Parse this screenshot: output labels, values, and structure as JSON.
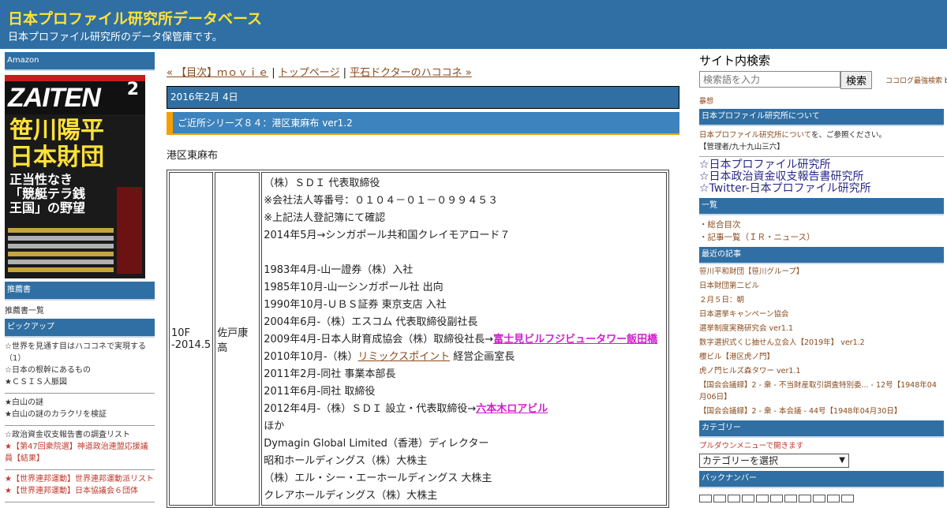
{
  "header": {
    "title": "日本プロファイル研究所データベース",
    "subtitle": "日本プロファイル研究所のデータ保管庫です。"
  },
  "left": {
    "amazon_label": "Amazon",
    "cover": {
      "masthead": "ZAITEN",
      "issue": "2",
      "headline": "笹川陽平日本財団",
      "subhead": "正当性なき「競艇テラ銭王国」の野望"
    },
    "recommended_label": "推薦書",
    "recommended_link": "推薦書一覧",
    "pickup_label": "ピックアップ",
    "pickup_groups": [
      [
        "☆世界を見通す目はハココネで実現する（1）",
        "☆日本の根幹にあるもの",
        "★ＣＳＩＳ人脈図"
      ],
      [
        "★白山の謎",
        "★白山の謎のカラクリを検証"
      ],
      [
        "☆政治資金収支報告書の調査リスト",
        "★【第47回衆院選】神道政治連盟応援議員【結果】"
      ],
      [
        "★【世界連邦運動】世界連邦運動派リスト",
        "★【世界連邦運動】日本協議会６団体"
      ]
    ]
  },
  "main": {
    "nav": {
      "prev": "« 【目次】ｍｏｖｉｅ",
      "sep": " | ",
      "top": "トップページ",
      "next": "平石ドクターのハココネ »"
    },
    "date": "2016年2月 4日",
    "entry_title": "ご近所シリーズ８４：港区東麻布 ver1.2",
    "area": "港区東麻布",
    "row": {
      "floor": "10F\n-2014.5",
      "name": "佐戸康高",
      "lines": [
        {
          "text": "（株）ＳＤＩ 代表取締役"
        },
        {
          "text": "※会社法人等番号：０１０４－０１－０９９４５３"
        },
        {
          "text": "※上記法人登記簿にて確認"
        },
        {
          "text": "2014年5月→シンガポール共和国クレイモアロード７"
        },
        {
          "text": ""
        },
        {
          "text": "1983年4月-山一證券（株）入社"
        },
        {
          "text": "1985年10月-山一シンガポール社 出向"
        },
        {
          "text": "1990年10月-ＵＢＳ証券 東京支店 入社"
        },
        {
          "text": "2004年6月-（株）エスコム 代表取締役副社長"
        },
        {
          "text": "2009年4月-日本人財育成協会（株）取締役社長→",
          "link": "富士見ビルフジビュータワー飯田橋",
          "link_style": "pink"
        },
        {
          "text": "2010年10月-（株）",
          "link": "リミックスポイント",
          "link_style": "brown",
          "after": " 経営企画室長"
        },
        {
          "text": "2011年2月-同社 事業本部長"
        },
        {
          "text": "2011年6月-同社 取締役"
        },
        {
          "text": "2012年4月-（株）ＳＤＩ 設立・代表取締役→",
          "link": "六本木ロアビル",
          "link_style": "pink"
        },
        {
          "text": "ほか"
        },
        {
          "text": "Dymagin Global Limited（香港）ディレクター"
        },
        {
          "text": "昭和ホールディングス（株）大株主"
        },
        {
          "text": "（株）エル・シー・エーホールディングス 大株主"
        },
        {
          "text": "クレアホールディングス（株）大株主"
        }
      ]
    }
  },
  "right": {
    "search_heading": "サイト内検索",
    "search_placeholder": "検索語を入力",
    "search_button": "検索",
    "search_credit_link": "ココログ最強検索",
    "search_credit_by": " by",
    "search_credit_name": "暴想",
    "about_label": "日本プロファイル研究所について",
    "about_link": "日本プロファイル研究所について",
    "about_text": "を、ご参照ください。",
    "admin_text": "【管理者/九十九山三六】",
    "big_links": [
      "☆日本プロファイル研究所",
      "☆日本政治資金収支報告書研究所",
      "☆Twitter-日本プロファイル研究所"
    ],
    "list_label": "一覧",
    "list_items": [
      "・総合目次",
      "・記事一覧（ＩＲ・ニュース）"
    ],
    "recent_label": "最近の記事",
    "recent_items": [
      "笹川平和財団【笹川グループ】",
      "日本財団第二ビル",
      "２月５日：朝",
      "日本選挙キャンペーン協会",
      "選挙制度実務研究会 ver1.1",
      "数字選択式くじ抽せん立会人【2019年】 ver1.2",
      "櫻ビル【港区虎ノ門】",
      "虎ノ門ヒルズ森タワー ver1.1",
      "【国会会議録】2 - 衆 - 不当財産取引調査特別委... - 12号【1948年04月06日】",
      "【国会会議録】2 - 衆 - 本会議 - 44号【1948年04月30日】"
    ],
    "category_label": "カテゴリー",
    "category_note": "プルダウンメニューで開きます",
    "category_select": "カテゴリーを選択",
    "backnumber_label": "バックナンバー"
  },
  "colors": {
    "header_bg": "#2f6fa3",
    "title_yellow": "#ffe23a",
    "link_brown": "#8a4a1c",
    "accent_orange": "#f5a000",
    "pink_link": "#d21ccf"
  }
}
